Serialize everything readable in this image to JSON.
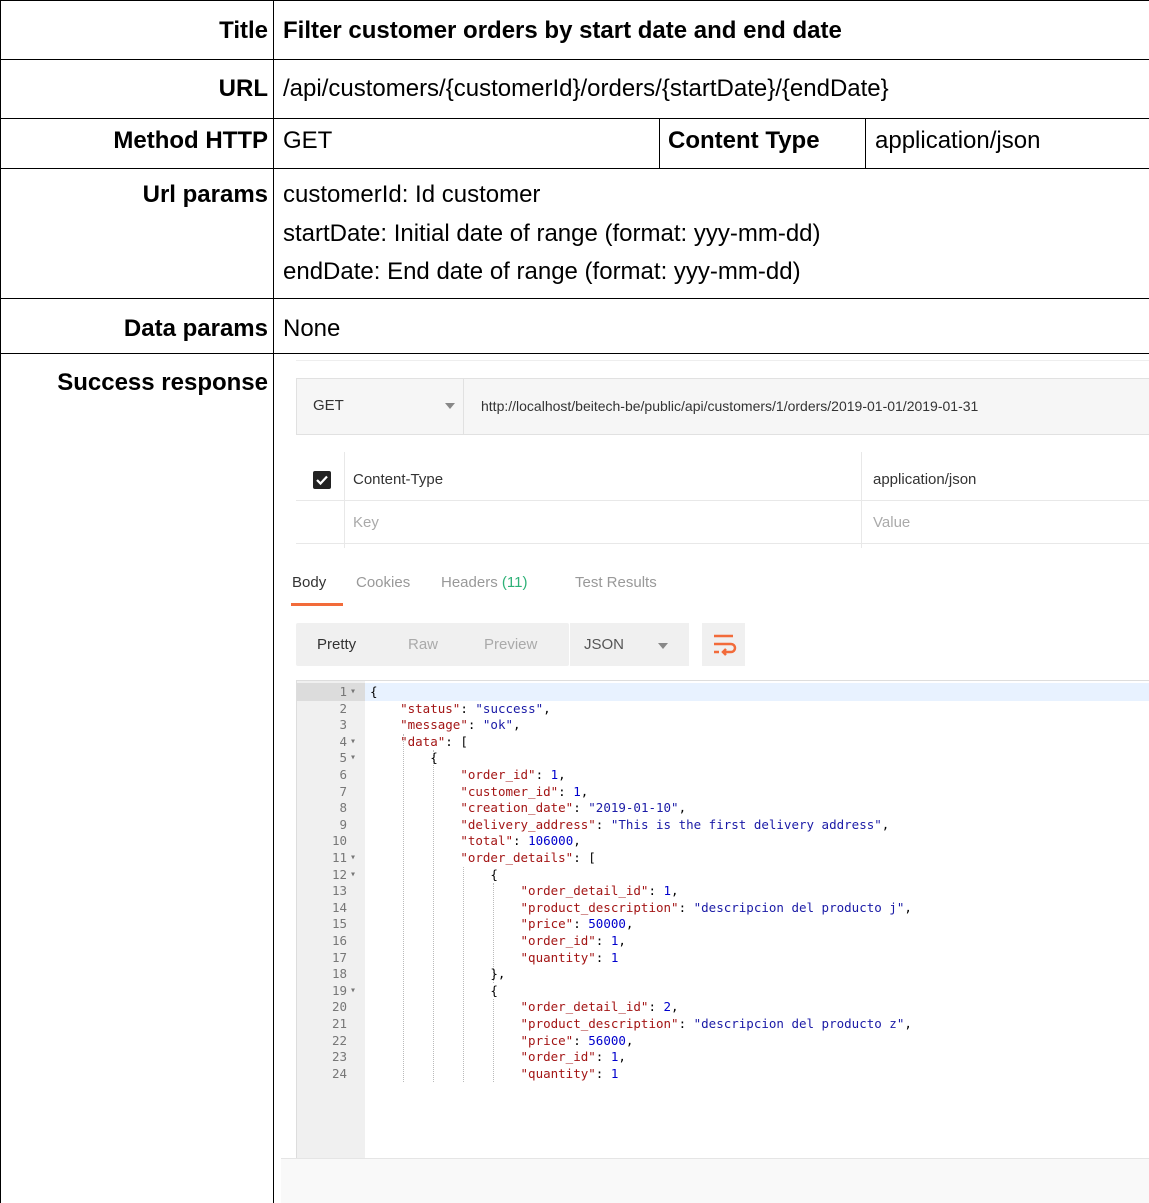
{
  "doc": {
    "title_label": "Title",
    "title_value": "Filter customer orders by start date and end date",
    "url_label": "URL",
    "url_value": "/api/customers/{customerId}/orders/{startDate}/{endDate}",
    "method_label": "Method HTTP",
    "method_value": "GET",
    "content_type_label": "Content Type",
    "content_type_value": "application/json",
    "url_params_label": "Url params",
    "url_params_lines": [
      "customerId: Id customer",
      "startDate: Initial date of range (format: yyy-mm-dd)",
      "endDate: End date of range (format: yyy-mm-dd)"
    ],
    "data_params_label": "Data params",
    "data_params_value": "None",
    "success_label": "Success response"
  },
  "postman": {
    "method": "GET",
    "url": "http://localhost/beitech-be/public/api/customers/1/orders/2019-01-01/2019-01-31",
    "headers": [
      {
        "key": "Content-Type",
        "value": "application/json",
        "checked": true
      }
    ],
    "key_placeholder": "Key",
    "value_placeholder": "Value",
    "tabs": [
      {
        "label": "Body"
      },
      {
        "label": "Cookies"
      },
      {
        "label": "Headers",
        "count": "(11)"
      },
      {
        "label": "Test Results"
      }
    ],
    "format_options": [
      "Pretty",
      "Raw",
      "Preview"
    ],
    "format_type": "JSON",
    "accent_color": "#f26b3a",
    "count_color": "#2eb177",
    "code_lines": [
      {
        "n": "1",
        "fold": "▾",
        "text": "{"
      },
      {
        "n": "2",
        "fold": "",
        "text": "    \"status\": \"success\","
      },
      {
        "n": "3",
        "fold": "",
        "text": "    \"message\": \"ok\","
      },
      {
        "n": "4",
        "fold": "▾",
        "text": "    \"data\": ["
      },
      {
        "n": "5",
        "fold": "▾",
        "text": "        {"
      },
      {
        "n": "6",
        "fold": "",
        "text": "            \"order_id\": 1,"
      },
      {
        "n": "7",
        "fold": "",
        "text": "            \"customer_id\": 1,"
      },
      {
        "n": "8",
        "fold": "",
        "text": "            \"creation_date\": \"2019-01-10\","
      },
      {
        "n": "9",
        "fold": "",
        "text": "            \"delivery_address\": \"This is the first delivery address\","
      },
      {
        "n": "10",
        "fold": "",
        "text": "            \"total\": 106000,"
      },
      {
        "n": "11",
        "fold": "▾",
        "text": "            \"order_details\": ["
      },
      {
        "n": "12",
        "fold": "▾",
        "text": "                {"
      },
      {
        "n": "13",
        "fold": "",
        "text": "                    \"order_detail_id\": 1,"
      },
      {
        "n": "14",
        "fold": "",
        "text": "                    \"product_description\": \"descripcion del producto j\","
      },
      {
        "n": "15",
        "fold": "",
        "text": "                    \"price\": 50000,"
      },
      {
        "n": "16",
        "fold": "",
        "text": "                    \"order_id\": 1,"
      },
      {
        "n": "17",
        "fold": "",
        "text": "                    \"quantity\": 1"
      },
      {
        "n": "18",
        "fold": "",
        "text": "                },"
      },
      {
        "n": "19",
        "fold": "▾",
        "text": "                {"
      },
      {
        "n": "20",
        "fold": "",
        "text": "                    \"order_detail_id\": 2,"
      },
      {
        "n": "21",
        "fold": "",
        "text": "                    \"product_description\": \"descripcion del producto z\","
      },
      {
        "n": "22",
        "fold": "",
        "text": "                    \"price\": 56000,"
      },
      {
        "n": "23",
        "fold": "",
        "text": "                    \"order_id\": 1,"
      },
      {
        "n": "24",
        "fold": "",
        "text": "                    \"quantity\": 1"
      }
    ]
  }
}
